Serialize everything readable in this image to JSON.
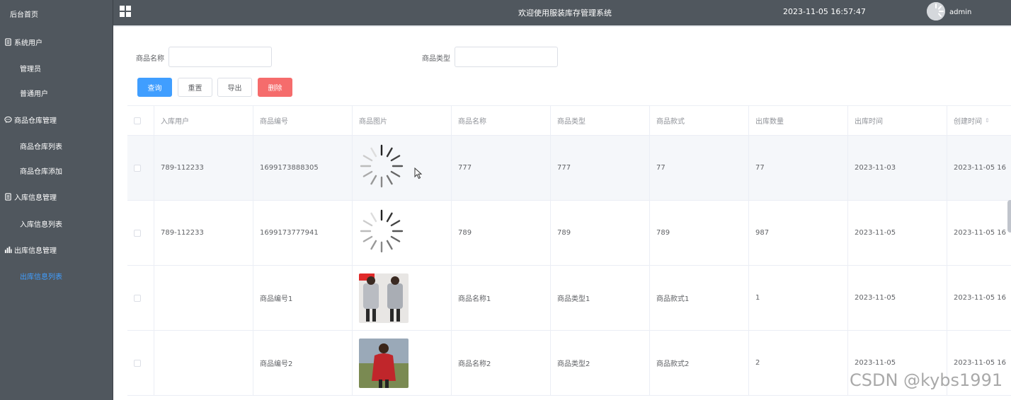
{
  "sidebar": {
    "home": "后台首页",
    "groups": [
      {
        "label": "系统用户",
        "icon": "document-icon",
        "items": [
          "管理员",
          "普通用户"
        ]
      },
      {
        "label": "商品仓库管理",
        "icon": "chat-icon",
        "items": [
          "商品仓库列表",
          "商品仓库添加"
        ]
      },
      {
        "label": "入库信息管理",
        "icon": "document-icon",
        "items": [
          "入库信息列表"
        ]
      },
      {
        "label": "出库信息管理",
        "icon": "bar-chart-icon",
        "items": [
          "出库信息列表"
        ]
      }
    ],
    "active_item": "出库信息列表",
    "active_color": "#409eff"
  },
  "header": {
    "title": "欢迎使用服装库存管理系统",
    "datetime": "2023-11-05 16:57:47",
    "username": "admin"
  },
  "search": {
    "name_label": "商品名称",
    "name_value": "",
    "type_label": "商品类型",
    "type_value": ""
  },
  "buttons": {
    "query": "查询",
    "reset": "重置",
    "export": "导出",
    "delete": "删除"
  },
  "colors": {
    "primary": "#409eff",
    "danger": "#f56c6c",
    "sidebar_bg": "#50575e"
  },
  "table": {
    "columns": [
      "入库用户",
      "商品编号",
      "商品图片",
      "商品名称",
      "商品类型",
      "商品款式",
      "出库数量",
      "出库时间",
      "创建时间"
    ],
    "sortable_column": "创建时间",
    "rows": [
      {
        "user": "789-112233",
        "code": "1699173888305",
        "image": "loading-spinner",
        "name": "777",
        "type": "777",
        "style": "77",
        "qty": "77",
        "out_time": "2023-11-03",
        "created": "2023-11-05 16",
        "hovered": true
      },
      {
        "user": "789-112233",
        "code": "1699173777941",
        "image": "loading-spinner",
        "name": "789",
        "type": "789",
        "style": "789",
        "qty": "987",
        "out_time": "2023-11-05",
        "created": "2023-11-05 16",
        "hovered": false
      },
      {
        "user": "",
        "code": "商品编号1",
        "image": "grey-coat-photo",
        "name": "商品名称1",
        "type": "商品类型1",
        "style": "商品款式1",
        "qty": "1",
        "out_time": "2023-11-05",
        "created": "2023-11-05 16",
        "hovered": false
      },
      {
        "user": "",
        "code": "商品编号2",
        "image": "red-coat-photo",
        "name": "商品名称2",
        "type": "商品类型2",
        "style": "商品款式2",
        "qty": "2",
        "out_time": "2023-11-05",
        "created": "2023-11-05 16",
        "hovered": false
      }
    ]
  },
  "watermark": "CSDN @kybs1991"
}
